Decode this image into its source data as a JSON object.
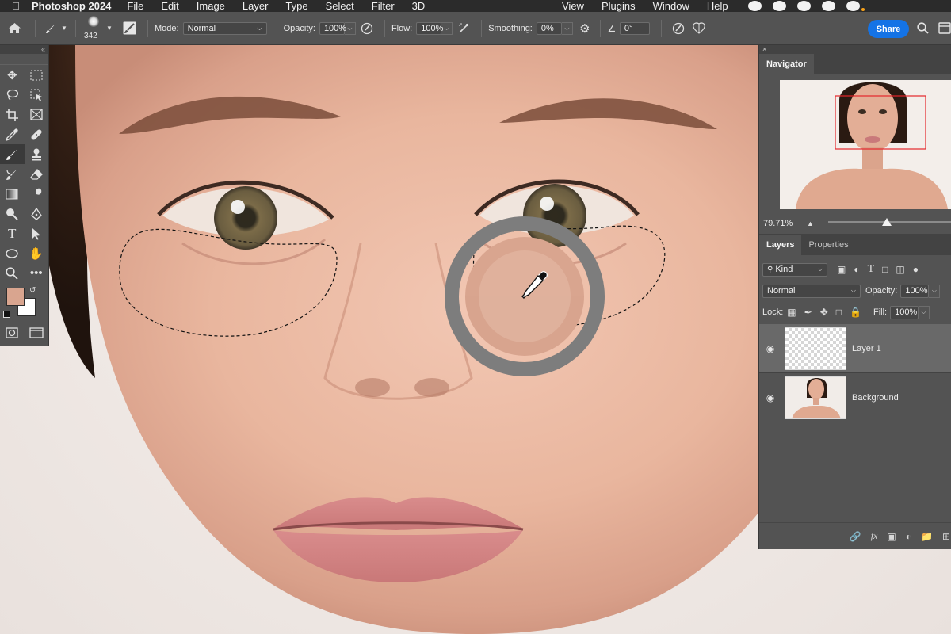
{
  "menubar": {
    "app_name": "Photoshop 2024",
    "menus": [
      "File",
      "Edit",
      "Image",
      "Layer",
      "Type",
      "Select",
      "Filter",
      "3D"
    ],
    "right_menus": [
      "View",
      "Plugins",
      "Window",
      "Help"
    ]
  },
  "options": {
    "brush_size": "342",
    "mode_label": "Mode:",
    "mode_value": "Normal",
    "opacity_label": "Opacity:",
    "opacity_value": "100%",
    "flow_label": "Flow:",
    "flow_value": "100%",
    "smoothing_label": "Smoothing:",
    "smoothing_value": "0%",
    "angle_value": "0°",
    "share_label": "Share"
  },
  "colors": {
    "foreground": "#d9a58f",
    "background": "#ffffff",
    "accent": "#1473e6",
    "navigator_frame": "#e4262b",
    "sampler_ring": "#7d7d7d",
    "sampler_top": "#d9a58f",
    "sampler_bottom": "#d8a48e"
  },
  "navigator": {
    "tab": "Navigator",
    "zoom": "79.71%"
  },
  "layers_panel": {
    "tabs": [
      "Layers",
      "Properties"
    ],
    "filter_value": "Kind",
    "blend_mode": "Normal",
    "opacity_label": "Opacity:",
    "opacity_value": "100%",
    "lock_label": "Lock:",
    "fill_label": "Fill:",
    "fill_value": "100%",
    "layers": [
      {
        "name": "Layer 1",
        "selected": true
      },
      {
        "name": "Background",
        "selected": false
      }
    ]
  },
  "icons": {
    "toolbar": [
      "home-icon",
      "brush-icon",
      "brush-settings-icon",
      "airbrush-icon",
      "gear-icon",
      "angle-icon",
      "pressure-icon",
      "symmetry-icon",
      "search-icon",
      "panels-icon"
    ],
    "tools": [
      "move-icon",
      "marquee-icon",
      "lasso-icon",
      "object-select-icon",
      "crop-icon",
      "frame-icon",
      "eyedropper-icon",
      "healing-icon",
      "brush-icon",
      "stamp-icon",
      "history-brush-icon",
      "eraser-icon",
      "gradient-icon",
      "smudge-icon",
      "dodge-icon",
      "pen-icon",
      "type-icon",
      "path-select-icon",
      "shape-icon",
      "hand-icon",
      "zoom-icon",
      "more-icon"
    ]
  }
}
